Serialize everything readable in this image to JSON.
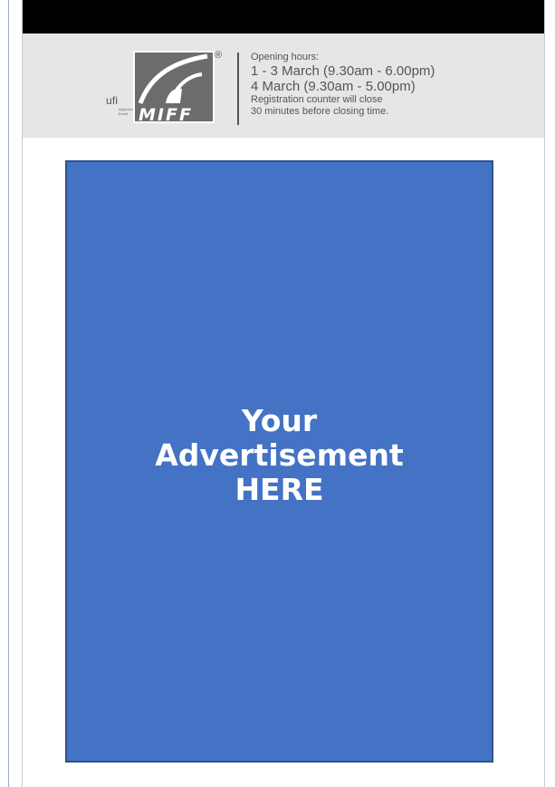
{
  "header": {
    "ufi_text": "ufi",
    "ufi_subtext": "Approved Event",
    "logo_text": "MIFF",
    "registered_mark": "®",
    "hours_title": "Opening hours:",
    "hours_line1": "1 - 3 March (9.30am - 6.00pm)",
    "hours_line2": "4 March (9.30am - 5.00pm)",
    "notice_line1": "Registration counter will close",
    "notice_line2": "30 minutes before closing time."
  },
  "ad": {
    "line1": "Your",
    "line2": "Advertisement",
    "line3": "HERE",
    "color": "#4472c4"
  }
}
